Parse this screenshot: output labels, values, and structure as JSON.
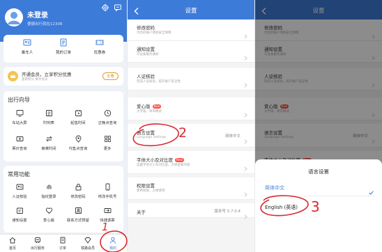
{
  "profile": {
    "username": "未登录",
    "subtitle": "便捷出行就在12306",
    "quick_links": [
      {
        "label": "乘车人",
        "icon": "passenger-icon"
      },
      {
        "label": "我的订单",
        "icon": "order-icon"
      },
      {
        "label": "优惠券",
        "icon": "coupon-icon"
      }
    ],
    "vip": {
      "title": "开通会员，立享积分优惠",
      "subtitle": "查看积分 尊享会员",
      "button": "去看"
    },
    "guide": {
      "title": "出行向导",
      "items": [
        {
          "label": "车站大屏",
          "icon": "station-screen-icon"
        },
        {
          "label": "时刻表",
          "icon": "timetable-icon"
        },
        {
          "label": "起售时间",
          "icon": "sale-time-icon"
        },
        {
          "label": "正晚点查询",
          "icon": "delay-query-icon"
        },
        {
          "label": "票价查询",
          "icon": "fare-query-icon"
        },
        {
          "label": "换乘时间",
          "icon": "transfer-time-icon"
        },
        {
          "label": "代售点查询",
          "icon": "agency-query-icon"
        },
        {
          "label": "更多",
          "icon": "more-icon"
        }
      ]
    },
    "common": {
      "title": "常用功能",
      "items": [
        {
          "label": "人证核验",
          "icon": "id-verify-icon"
        },
        {
          "label": "指纹登录",
          "icon": "fingerprint-icon"
        },
        {
          "label": "修改密码",
          "icon": "password-icon"
        },
        {
          "label": "修改手机号",
          "icon": "phone-icon"
        },
        {
          "label": "通知设置",
          "icon": "notification-icon"
        },
        {
          "label": "爱心版",
          "icon": "heart-icon"
        },
        {
          "label": "联系方式预留",
          "icon": "contact-icon"
        },
        {
          "label": "快捷退票",
          "icon": "refund-icon"
        }
      ]
    },
    "tabs": [
      {
        "label": "首页",
        "icon": "home-icon",
        "active": false
      },
      {
        "label": "出行服务",
        "icon": "travel-service-icon",
        "active": false
      },
      {
        "label": "订单",
        "icon": "order-tab-icon",
        "active": false
      },
      {
        "label": "铁路会员",
        "icon": "member-icon",
        "active": false
      },
      {
        "label": "我的",
        "icon": "profile-tab-icon",
        "active": true
      }
    ]
  },
  "settings": {
    "title": "设置",
    "rows": [
      {
        "title": "修改密码",
        "subtitle": "为您的账户增加安全保障",
        "value": "",
        "new": false
      },
      {
        "title": "通知设置",
        "subtitle": "可设备服务通知",
        "value": "",
        "new": false
      },
      {
        "title": "人证核验",
        "subtitle": "完成人证核验，提升账户安全性",
        "value": "",
        "new": false
      },
      {
        "title": "爱心版",
        "subtitle": "大字版，简单模式",
        "value": "",
        "new": true
      },
      {
        "title": "语言设置",
        "subtitle": "Language Settings",
        "value": "简体中文",
        "new": false
      },
      {
        "title": "字体大小及对比度",
        "subtitle": "设置字体大小及对比度，方便查看内容",
        "value": "",
        "new": true
      },
      {
        "title": "权限设置",
        "subtitle": "使用权限，方便使用",
        "value": "",
        "new": false
      },
      {
        "title": "关于",
        "subtitle": "",
        "value": "版本号 5.7.0.4",
        "new": false
      }
    ],
    "new_badge": "New"
  },
  "language_sheet": {
    "title": "语言设置",
    "options": [
      {
        "label": "简体中文",
        "selected": true
      },
      {
        "label": "English (英语)",
        "selected": false
      }
    ]
  },
  "annotations": [
    "1",
    "2",
    "3"
  ],
  "colors": {
    "primary": "#3d7bd8",
    "annotation": "#d8292f",
    "vip_gold": "#e19a2b",
    "new_badge": "#ff4f44"
  }
}
